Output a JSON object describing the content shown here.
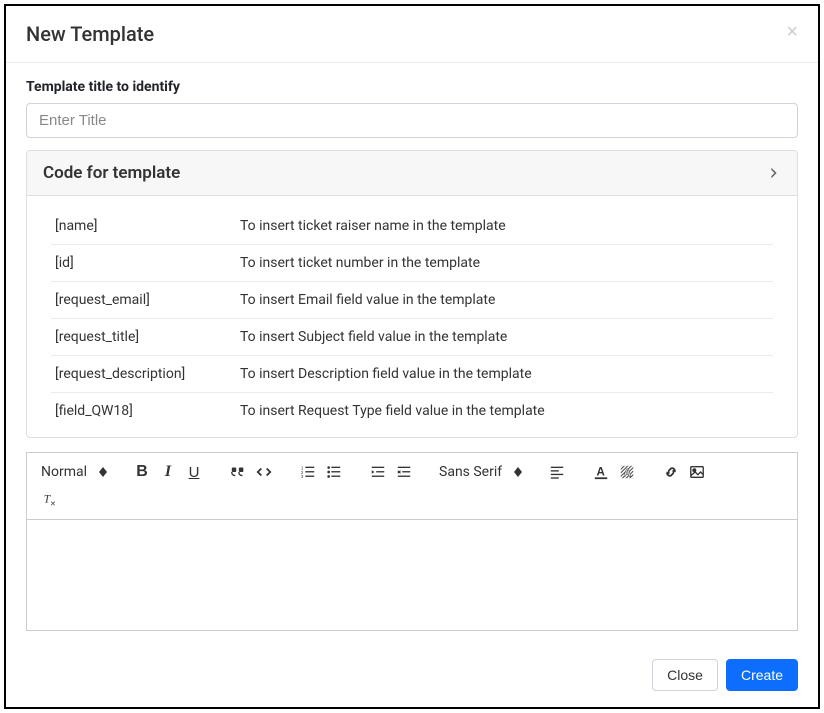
{
  "modal": {
    "title": "New Template"
  },
  "form": {
    "title_label": "Template title to identify",
    "title_placeholder": "Enter Title",
    "title_value": ""
  },
  "accordion": {
    "title": "Code for template",
    "codes": [
      {
        "key": "[name]",
        "desc": "To insert ticket raiser name in the template"
      },
      {
        "key": "[id]",
        "desc": "To insert ticket number in the template"
      },
      {
        "key": "[request_email]",
        "desc": "To insert Email field value in the template"
      },
      {
        "key": "[request_title]",
        "desc": "To insert Subject field value in the template"
      },
      {
        "key": "[request_description]",
        "desc": "To insert Description field value in the template"
      },
      {
        "key": "[field_QW18]",
        "desc": "To insert Request Type field value in the template"
      }
    ]
  },
  "toolbar": {
    "heading": "Normal",
    "font": "Sans Serif"
  },
  "footer": {
    "close": "Close",
    "create": "Create"
  }
}
